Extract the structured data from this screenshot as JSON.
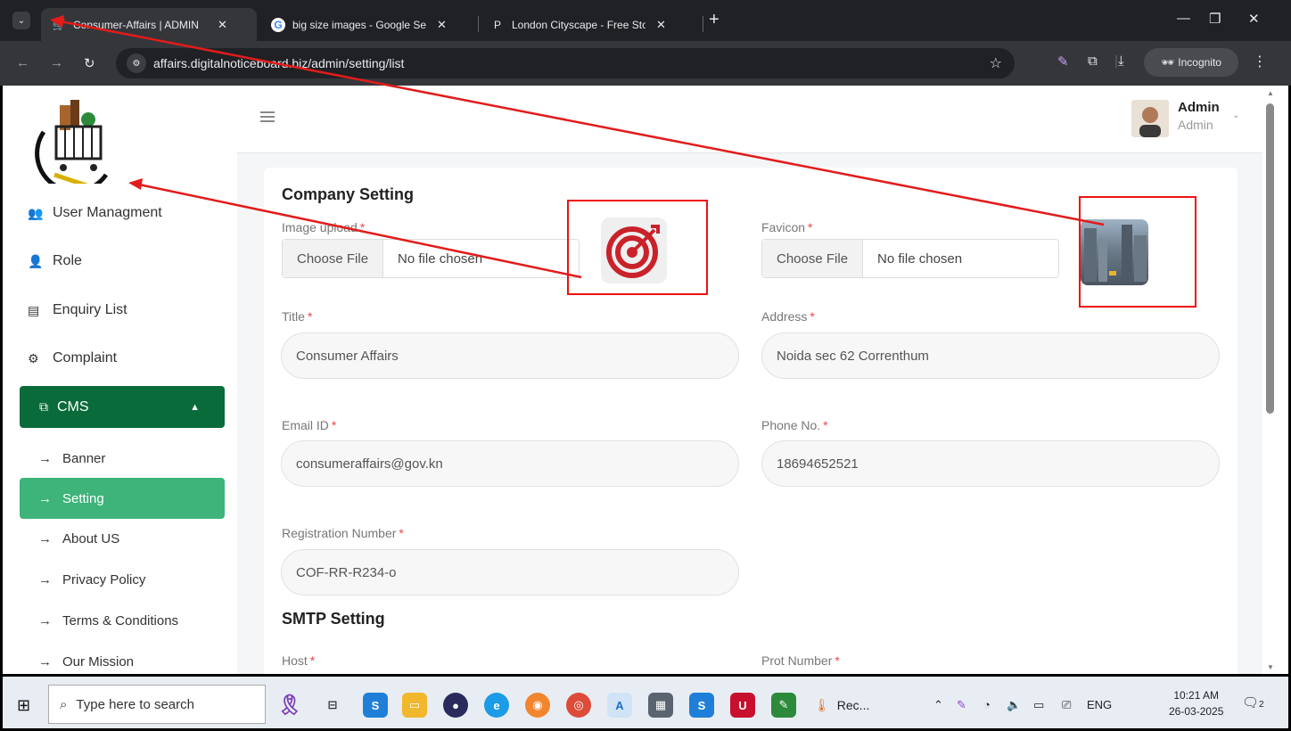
{
  "browser": {
    "tabs": [
      {
        "title": "Consumer-Affairs | ADMIN",
        "active": true
      },
      {
        "title": "big size images - Google Searc",
        "active": false
      },
      {
        "title": "London Cityscape - Free Stock F",
        "active": false
      }
    ],
    "url": "affairs.digitalnoticeboard.biz/admin/setting/list",
    "incognito_label": "Incognito"
  },
  "header": {
    "user_name": "Admin",
    "user_role": "Admin"
  },
  "sidebar": {
    "items": [
      {
        "label": "User Managment",
        "icon": "users-icon"
      },
      {
        "label": "Role",
        "icon": "user-icon"
      },
      {
        "label": "Enquiry List",
        "icon": "id-card-icon"
      },
      {
        "label": "Complaint",
        "icon": "gear-icon"
      }
    ],
    "cms_label": "CMS",
    "sub_items": [
      "Banner",
      "Setting",
      "About US",
      "Privacy Policy",
      "Terms & Conditions",
      "Our Mission"
    ],
    "active_sub": "Setting"
  },
  "company": {
    "heading": "Company Setting",
    "image_upload_label": "Image upload",
    "favicon_label": "Favicon",
    "choose_file": "Choose File",
    "no_file": "No file chosen",
    "title_label": "Title",
    "title_value": "Consumer Affairs",
    "address_label": "Address",
    "address_value": "Noida sec 62  Correnthum",
    "email_label": "Email ID",
    "email_value": "consumeraffairs@gov.kn",
    "phone_label": "Phone No.",
    "phone_value": "18694652521",
    "reg_label": "Registration Number",
    "reg_value": "COF-RR-R234-o",
    "required_mark": "*"
  },
  "smtp": {
    "heading": "SMTP Setting",
    "host_label": "Host",
    "port_label": "Prot Number"
  },
  "taskbar": {
    "search_placeholder": "Type here to search",
    "rec_label": "Rec...",
    "lang": "ENG",
    "time": "10:21 AM",
    "date": "26-03-2025",
    "notif_count": "2"
  },
  "annotation_color": "#e31b1b"
}
